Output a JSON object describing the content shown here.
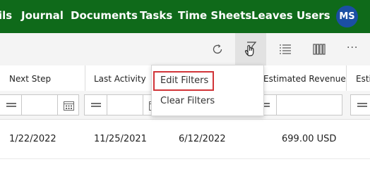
{
  "nav": {
    "items": [
      "ils",
      "Journal",
      "Documents",
      "Tasks",
      "Time Sheets",
      "Leaves",
      "Users"
    ],
    "avatar_initials": "MS"
  },
  "toolbar": {
    "icons": [
      "refresh-icon",
      "filter-hand-icon",
      "list-icon",
      "columns-icon",
      "more-icon"
    ],
    "more_label": "···"
  },
  "columns": [
    "Next Step",
    "Last Activity",
    "",
    "Estimated Revenue",
    "Esti"
  ],
  "filter_menu": {
    "items": [
      "Edit Filters",
      "Clear Filters"
    ],
    "highlighted": "Edit Filters"
  },
  "rows": [
    {
      "next_step": "1/22/2022",
      "last_activity": "11/25/2021",
      "date3": "6/12/2022",
      "estimated_revenue": "699.00 USD"
    }
  ],
  "colors": {
    "nav_bg": "#0f6a1a",
    "avatar_bg": "#1b4fa3",
    "highlight_border": "#d13438"
  }
}
